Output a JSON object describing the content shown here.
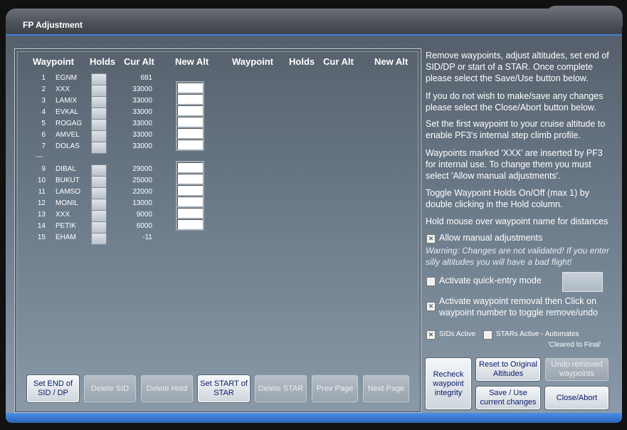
{
  "window": {
    "title": "FP Adjustment"
  },
  "headers": {
    "waypoint": "Waypoint",
    "holds": "Holds",
    "cur_alt": "Cur Alt",
    "new_alt": "New Alt",
    "waypoint2": "Waypoint",
    "holds2": "Holds",
    "cur_alt2": "Cur Alt",
    "new_alt2": "New Alt"
  },
  "separator": "---",
  "rows": [
    {
      "num": "1",
      "wp": "EGNM",
      "cur": "681"
    },
    {
      "num": "2",
      "wp": "XXX",
      "cur": "33000"
    },
    {
      "num": "3",
      "wp": "LAMIX",
      "cur": "33000"
    },
    {
      "num": "4",
      "wp": "EVKAL",
      "cur": "33000"
    },
    {
      "num": "5",
      "wp": "ROGAG",
      "cur": "33000"
    },
    {
      "num": "6",
      "wp": "AMVEL",
      "cur": "33000"
    },
    {
      "num": "7",
      "wp": "DOLAS",
      "cur": "33000"
    },
    {
      "num": "9",
      "wp": "DIBAL",
      "cur": "29000"
    },
    {
      "num": "10",
      "wp": "BUKUT",
      "cur": "25000"
    },
    {
      "num": "11",
      "wp": "LAMSO",
      "cur": "22000"
    },
    {
      "num": "12",
      "wp": "MONIL",
      "cur": "13000"
    },
    {
      "num": "13",
      "wp": "XXX",
      "cur": "9000"
    },
    {
      "num": "14",
      "wp": "PETIK",
      "cur": "6000"
    },
    {
      "num": "15",
      "wp": "EHAM",
      "cur": "-11"
    }
  ],
  "buttons": {
    "set_end": "Set END of SID / DP",
    "delete_sid": "Delete SID",
    "delete_hold": "Delete Hold",
    "set_start": "Set START of STAR",
    "delete_star": "Delete STAR",
    "prev_page": "Prev Page",
    "next_page": "Next Page",
    "recheck": "Recheck waypoint integrity",
    "reset": "Reset to Original Altitudes",
    "undo": "Undo removed waypoints",
    "save": "Save / Use current changes",
    "close": "Close/Abort"
  },
  "info": {
    "p1": "Remove waypoints, adjust altitudes, set end of SID/DP or start of a STAR. Once complete please select the Save/Use button below.",
    "p2": "If you do not wish to make/save any changes please select the Close/Abort button below.",
    "p3": "Set the first waypoint to your cruise altitude to enable PF3's internal step climb profile.",
    "p4": "Waypoints marked 'XXX' are inserted by PF3 for internal use. To change them you must select 'Allow manual adjustments'.",
    "p5": "Toggle Waypoint Holds On/Off (max 1) by double clicking in the Hold column.",
    "p6": "Hold mouse over waypoint name for distances"
  },
  "options": {
    "allow_manual": "Allow manual adjustments",
    "warning": "Warning: Changes are not validated! If you enter silly altitudes you will have a bad flight!",
    "quick_entry": "Activate quick-entry mode",
    "removal": "Activate waypoint removal then Click on waypoint number to toggle remove/undo",
    "sids_active": "SIDs Active",
    "stars_active": "STARs Active - Automates",
    "cleared_final": "'Cleared to Final'"
  }
}
